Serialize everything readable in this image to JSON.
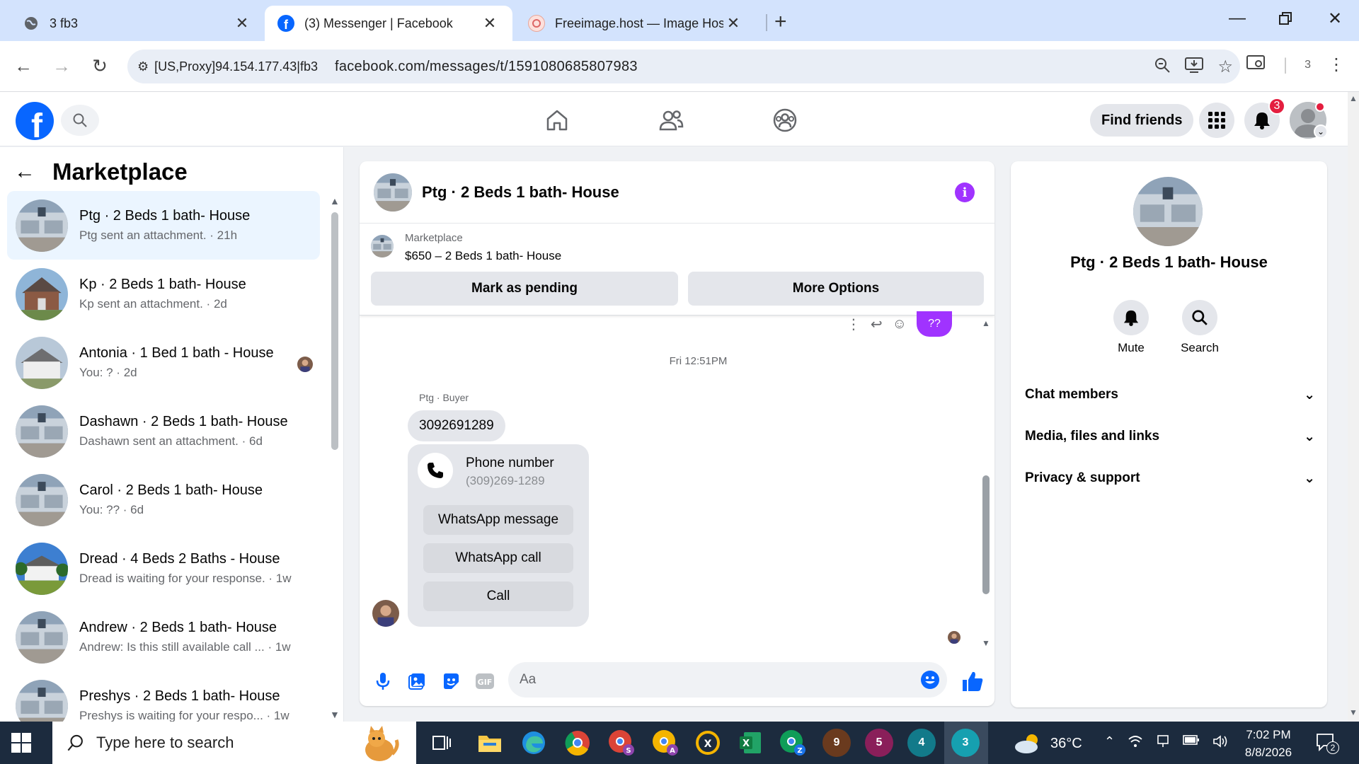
{
  "browser": {
    "tabs": [
      {
        "title": "3 fb3",
        "close": "✕"
      },
      {
        "title": "(3) Messenger | Facebook",
        "close": "✕"
      },
      {
        "title": "Freeimage.host — Image Hostin",
        "close": "✕"
      }
    ],
    "new_tab": "+",
    "omnibox": {
      "site_info": "[US,Proxy]94.154.177.43|fb3",
      "url": "facebook.com/messages/t/1591080685807983"
    },
    "extension_count": "3"
  },
  "header": {
    "find_friends": "Find friends",
    "notification_count": "3"
  },
  "sidebar": {
    "title": "Marketplace",
    "conversations": [
      {
        "name": "Ptg · 2 Beds 1 bath- House",
        "sub": "Ptg sent an attachment. · 21h"
      },
      {
        "name": "Kp · 2 Beds 1 bath- House",
        "sub": "Kp sent an attachment. · 2d"
      },
      {
        "name": "Antonia · 1 Bed 1 bath - House",
        "sub": "You: ? · 2d"
      },
      {
        "name": "Dashawn · 2 Beds 1 bath- House",
        "sub": "Dashawn sent an attachment. · 6d"
      },
      {
        "name": "Carol · 2 Beds 1 bath- House",
        "sub": "You: ?? · 6d"
      },
      {
        "name": "Dread · 4 Beds 2 Baths - House",
        "sub": "Dread is waiting for your response. · 1w"
      },
      {
        "name": "Andrew · 2 Beds 1 bath- House",
        "sub": "Andrew: Is this still available call ...   · 1w"
      },
      {
        "name": "Preshys · 2 Beds 1 bath- House",
        "sub": "Preshys is waiting for your respo...   · 1w"
      }
    ]
  },
  "chat": {
    "title": "Ptg · 2 Beds 1 bath- House",
    "marketplace_label": "Marketplace",
    "listing": "$650 – 2 Beds 1 bath- House",
    "mark_pending": "Mark as pending",
    "more_options": "More Options",
    "prev_bubble": "??",
    "timestamp": "Fri 12:51PM",
    "sender_label": "Ptg · Buyer",
    "message_number": "3092691289",
    "phone_card": {
      "title": "Phone number",
      "number": "(309)269-1289",
      "whatsapp_message": "WhatsApp message",
      "whatsapp_call": "WhatsApp call",
      "call": "Call"
    },
    "composer_placeholder": "Aa"
  },
  "details": {
    "title": "Ptg · 2 Beds 1 bath- House",
    "mute": "Mute",
    "search": "Search",
    "sections": [
      "Chat members",
      "Media, files and links",
      "Privacy & support"
    ]
  },
  "taskbar": {
    "search_placeholder": "Type here to search",
    "temperature": "36°C",
    "time": "7:02 PM",
    "date": "8/8/2026",
    "notification_count": "2",
    "app_badges": [
      "9",
      "5",
      "4",
      "3"
    ]
  },
  "colors": {
    "facebook_blue": "#0866ff",
    "messenger_purple": "#a033ff",
    "active_conversation_bg": "#ebf5ff",
    "taskbar": "#1c2b3e"
  }
}
